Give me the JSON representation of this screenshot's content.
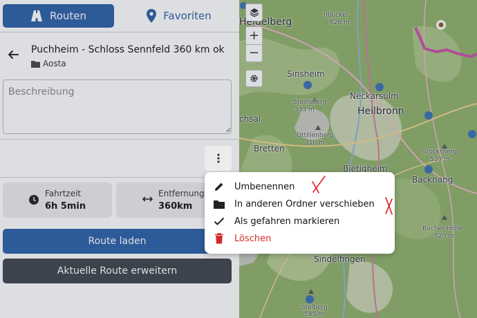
{
  "tabs": {
    "routes": "Routen",
    "favorites": "Favoriten"
  },
  "route": {
    "title": "Puchheim - Schloss Sennfeld 360 km ok",
    "folder": "Aosta"
  },
  "description": {
    "placeholder": "Beschreibung"
  },
  "stats": {
    "time": {
      "label": "Fahrtzeit",
      "value": "6h 5min"
    },
    "distance": {
      "label": "Entfernung",
      "value": "360km"
    }
  },
  "buttons": {
    "load": "Route laden",
    "extend": "Aktuelle Route erweitern"
  },
  "menu": {
    "rename": "Umbenennen",
    "move": "In anderen Ordner verschieben",
    "mark_driven": "Als gefahren markieren",
    "delete": "Löschen"
  },
  "map": {
    "zoom_in": "+",
    "zoom_out": "−",
    "labels": {
      "heidelberg": "Heidelberg",
      "sinsheim": "Sinsheim",
      "steinsberg": "Steinsberg",
      "steinsberg_elev": "333 m",
      "neckarsulm": "Neckarsulm",
      "heilbronn": "Heilbronn",
      "ottilienberg": "Ottilienberg",
      "ottilienberg_elev": "310 m",
      "bretten": "Bretten",
      "bruchsal": "chsal",
      "stocksberg": "Stocksberg",
      "stocksberg_elev": "539 m",
      "bietigheim": "Bietigheim",
      "backnang": "Backnang",
      "bucher_hohe": "Bucher Höhe",
      "bucher_hohe_elev": "520 m",
      "sindelfingen": "Sindelfingen",
      "stelberg": "Stelberg",
      "stelberg_elev": "585 m",
      "buckel": "nbuckel",
      "buckel_elev": "626 m"
    }
  },
  "colors": {
    "primary": "#2a5fa7",
    "dark_button": "#3e434a",
    "danger": "#d22a2a",
    "route_line": "#c850a8"
  }
}
